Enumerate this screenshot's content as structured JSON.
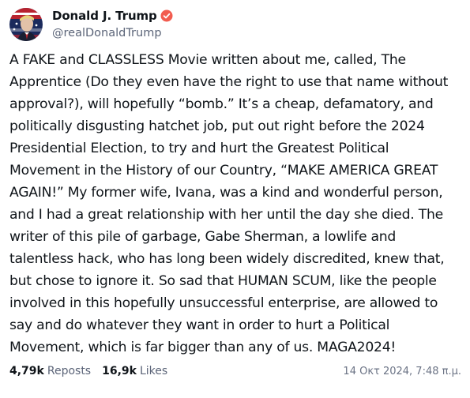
{
  "author": {
    "display_name": "Donald J. Trump",
    "handle": "@realDonaldTrump",
    "avatar_icon": "profile-avatar-icon",
    "verified_icon": "verified-badge-icon",
    "verified_color": "#f25c4f"
  },
  "post": {
    "text": "A FAKE and CLASSLESS Movie written about me, called, The Apprentice (Do they even have the right to use that name without approval?), will hopefully “bomb.” It’s a cheap, defamatory, and politically disgusting hatchet job, put out right before the 2024 Presidential Election, to try and hurt the Greatest Political Movement in the History of our Country, “MAKE AMERICA GREAT AGAIN!” My former wife, Ivana, was a kind and wonderful person, and I had a great relationship with her until the day she died. The writer of this pile of garbage, Gabe Sherman, a lowlife and talentless hack, who has long been widely discredited, knew that, but chose to ignore it. So sad that HUMAN SCUM, like the people involved in this hopefully unsuccessful enterprise, are allowed to say and do whatever they want in order to hurt a Political Movement, which is far bigger than any of us. MAGA2024!"
  },
  "stats": {
    "reposts_count": "4,79k",
    "reposts_label": "Reposts",
    "likes_count": "16,9k",
    "likes_label": "Likes"
  },
  "timestamp": "14 Οκτ 2024, 7:48 π.μ.",
  "colors": {
    "text": "#0f1419",
    "muted": "#5b6478",
    "background": "#ffffff"
  }
}
